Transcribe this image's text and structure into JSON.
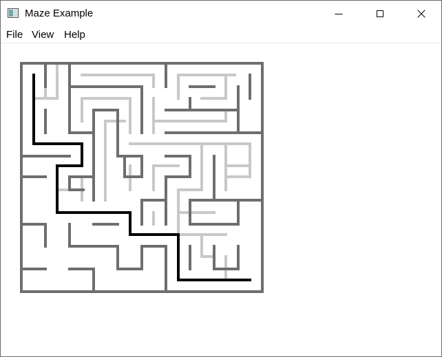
{
  "window": {
    "title": "Maze Example",
    "controls": [
      "minimize",
      "maximize",
      "close"
    ]
  },
  "menu": {
    "file": "File",
    "view": "View",
    "help": "Help"
  },
  "maze": {
    "colors": {
      "wall": "#6e6e6e",
      "explored": "#c8c8c8",
      "solution": "#000000"
    },
    "walls": [
      [
        30,
        91,
        380,
        91
      ],
      [
        30,
        91,
        30,
        423
      ],
      [
        380,
        91,
        380,
        423
      ],
      [
        30,
        423,
        380,
        423
      ],
      [
        65,
        91,
        65,
        125
      ],
      [
        100,
        91,
        100,
        192
      ],
      [
        240,
        91,
        240,
        125
      ],
      [
        100,
        125,
        205,
        125
      ],
      [
        205,
        125,
        205,
        192
      ],
      [
        275,
        125,
        310,
        125
      ],
      [
        345,
        125,
        345,
        192
      ],
      [
        362,
        108,
        362,
        142
      ],
      [
        240,
        159,
        345,
        159
      ],
      [
        275,
        142,
        275,
        159
      ],
      [
        135,
        159,
        170,
        159
      ],
      [
        135,
        159,
        135,
        192
      ],
      [
        170,
        159,
        170,
        226
      ],
      [
        65,
        159,
        65,
        192
      ],
      [
        240,
        192,
        380,
        192
      ],
      [
        100,
        192,
        135,
        192
      ],
      [
        30,
        226,
        100,
        226
      ],
      [
        135,
        192,
        135,
        290
      ],
      [
        170,
        226,
        205,
        226
      ],
      [
        205,
        226,
        205,
        256
      ],
      [
        180,
        256,
        205,
        256
      ],
      [
        180,
        226,
        180,
        256
      ],
      [
        240,
        226,
        275,
        226
      ],
      [
        275,
        226,
        275,
        256
      ],
      [
        240,
        256,
        275,
        256
      ],
      [
        240,
        256,
        240,
        290
      ],
      [
        310,
        226,
        310,
        290
      ],
      [
        275,
        290,
        310,
        290
      ],
      [
        275,
        290,
        275,
        325
      ],
      [
        100,
        256,
        135,
        256
      ],
      [
        100,
        256,
        100,
        275
      ],
      [
        100,
        275,
        120,
        275
      ],
      [
        30,
        256,
        65,
        256
      ],
      [
        205,
        290,
        240,
        290
      ],
      [
        205,
        290,
        205,
        325
      ],
      [
        240,
        290,
        240,
        325
      ],
      [
        310,
        290,
        380,
        290
      ],
      [
        345,
        290,
        345,
        325
      ],
      [
        275,
        325,
        345,
        325
      ],
      [
        30,
        325,
        65,
        325
      ],
      [
        65,
        325,
        65,
        357
      ],
      [
        100,
        325,
        100,
        357
      ],
      [
        100,
        357,
        135,
        357
      ],
      [
        135,
        325,
        170,
        325
      ],
      [
        135,
        357,
        170,
        357
      ],
      [
        170,
        357,
        170,
        390
      ],
      [
        170,
        390,
        205,
        390
      ],
      [
        205,
        357,
        205,
        390
      ],
      [
        205,
        357,
        240,
        357
      ],
      [
        240,
        357,
        240,
        423
      ],
      [
        345,
        357,
        345,
        390
      ],
      [
        310,
        390,
        345,
        390
      ],
      [
        310,
        357,
        310,
        390
      ],
      [
        30,
        390,
        65,
        390
      ],
      [
        100,
        390,
        135,
        390
      ],
      [
        135,
        390,
        135,
        423
      ],
      [
        275,
        357,
        275,
        390
      ]
    ],
    "explored": [
      [
        65,
        108,
        65,
        142
      ],
      [
        82,
        91,
        82,
        142
      ],
      [
        48,
        142,
        82,
        142
      ],
      [
        118,
        108,
        222,
        108
      ],
      [
        222,
        108,
        222,
        125
      ],
      [
        258,
        108,
        340,
        108
      ],
      [
        258,
        108,
        258,
        142
      ],
      [
        327,
        108,
        327,
        142
      ],
      [
        292,
        142,
        327,
        142
      ],
      [
        118,
        142,
        188,
        142
      ],
      [
        118,
        142,
        118,
        175
      ],
      [
        188,
        142,
        188,
        192
      ],
      [
        152,
        175,
        152,
        290
      ],
      [
        152,
        175,
        180,
        175
      ],
      [
        222,
        142,
        222,
        192
      ],
      [
        222,
        175,
        327,
        175
      ],
      [
        327,
        159,
        327,
        175
      ],
      [
        188,
        208,
        362,
        208
      ],
      [
        292,
        208,
        292,
        275
      ],
      [
        327,
        208,
        327,
        275
      ],
      [
        362,
        208,
        362,
        256
      ],
      [
        222,
        240,
        258,
        240
      ],
      [
        188,
        240,
        188,
        275
      ],
      [
        222,
        240,
        222,
        275
      ],
      [
        82,
        275,
        118,
        275
      ],
      [
        118,
        256,
        118,
        290
      ],
      [
        327,
        240,
        362,
        240
      ],
      [
        327,
        256,
        362,
        256
      ],
      [
        258,
        275,
        292,
        275
      ],
      [
        258,
        275,
        258,
        340
      ],
      [
        258,
        308,
        310,
        308
      ],
      [
        222,
        308,
        222,
        325
      ],
      [
        258,
        340,
        327,
        340
      ],
      [
        292,
        340,
        292,
        372
      ],
      [
        327,
        372,
        327,
        406
      ],
      [
        292,
        372,
        310,
        372
      ]
    ],
    "solution": [
      [
        48,
        108,
        48,
        208
      ],
      [
        48,
        208,
        118,
        208
      ],
      [
        118,
        208,
        118,
        240
      ],
      [
        118,
        240,
        82,
        240
      ],
      [
        82,
        240,
        82,
        308
      ],
      [
        82,
        308,
        188,
        308
      ],
      [
        188,
        308,
        188,
        340
      ],
      [
        188,
        340,
        258,
        340
      ],
      [
        258,
        340,
        258,
        406
      ],
      [
        258,
        406,
        362,
        406
      ]
    ]
  }
}
